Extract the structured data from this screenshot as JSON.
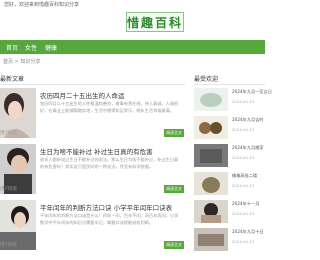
{
  "site": {
    "top_text": "您好，欢迎来到惜趣百科知识分享",
    "logo_text": "惜趣百科"
  },
  "nav": {
    "items": [
      "首页",
      "女性",
      "健康"
    ]
  },
  "breadcrumb": "首页 > 知识分享",
  "main": {
    "section_title": "最新文章",
    "more_label": "阅读全文",
    "articles": [
      {
        "title": "农历四月二十五出生的人命运",
        "summary": "农历四月二十五出生的人性格温和善良，做事有责任感，待人真诚，人缘很好，在事业上能够脚踏实地，生活中懂得知足常乐，晚年生活幸福美满。",
        "user": "用户",
        "views": "浏览"
      },
      {
        "title": "生日为啥不能补过 补过生日真的有危害",
        "summary": "很多人都听说过生日不能补过的说法，那么生日为啥不能补过，补过生日真的有危害吗？其实这只是民间的一种说法，并没有科学依据。",
        "user": "用户",
        "views": "浏览"
      },
      {
        "title": "平年闰年的判断方法口诀 小学平年闰年口诀表",
        "summary": "平年闰年的判断方法口诀是什么？四年一闰，百年不闰，四百年再闰。小学数学中平年闰年的知识点需要牢记，掌握口诀就能轻松判断。",
        "user": "用户",
        "views": "浏览"
      }
    ]
  },
  "sidebar": {
    "title": "最受欢迎",
    "items": [
      {
        "title": "2024年九月一至吉日",
        "date": "2024-05-13"
      },
      {
        "title": "2024年九月吉时",
        "date": "2024-05-13"
      },
      {
        "title": "2024年九月搬家",
        "date": "2024-05-13"
      },
      {
        "title": "佛像高低二楼",
        "date": "2024-05-13"
      },
      {
        "title": "2024年十一月",
        "date": "2024-05-13"
      },
      {
        "title": "2024年九月十日",
        "date": "2024-05-13"
      }
    ]
  },
  "colors": {
    "accent": "#56a83d"
  }
}
